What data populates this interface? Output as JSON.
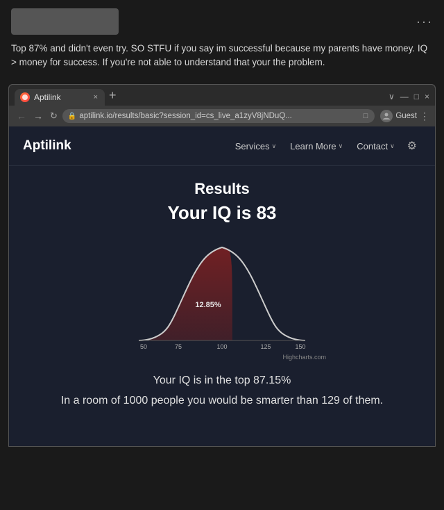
{
  "post": {
    "text": "Top 87% and didn't even try. SO STFU if you say im successful because my parents have money. IQ > money for success. If you're not able to understand that your the problem.",
    "three_dots": "···"
  },
  "browser": {
    "tab_label": "Aptilink",
    "tab_new_label": "+",
    "address_url": "aptilink.io/results/basic?session_id=cs_live_a1zyV8jNDuQ...",
    "guest_label": "Guest",
    "window_controls": [
      "∨",
      "—",
      "□",
      "×"
    ]
  },
  "site": {
    "logo": "Aptilink",
    "nav": {
      "services": "Services",
      "services_chevron": "∨",
      "learn_more": "Learn More",
      "learn_more_chevron": "∨",
      "contact": "Contact",
      "contact_chevron": "∨"
    },
    "results": {
      "title": "Results",
      "iq_headline": "Your IQ is 83",
      "percentage_label": "12.85%",
      "x_axis_labels": [
        "50",
        "75",
        "100",
        "125",
        "150"
      ],
      "top_percent_text": "Your IQ is in the top 87.15%",
      "room_text": "In a room of 1000 people you would be smarter than 129 of them.",
      "highcharts_credit": "Highcharts.com"
    }
  }
}
